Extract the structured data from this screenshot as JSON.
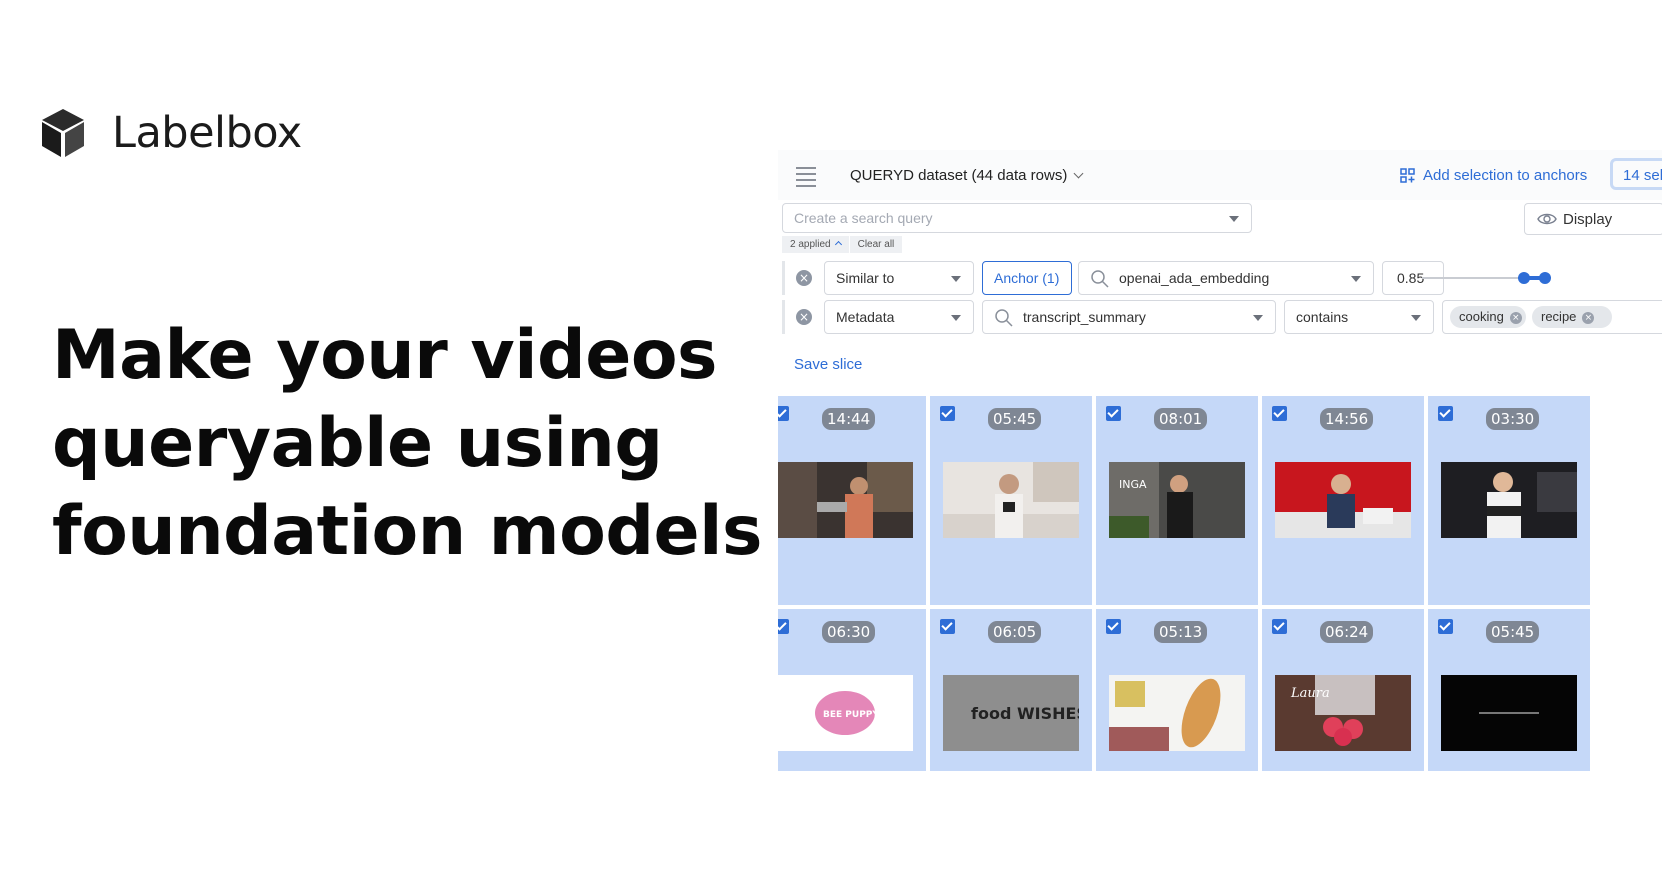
{
  "brand": {
    "name": "Labelbox"
  },
  "headline": {
    "line1": "Make your videos",
    "line2": "queryable using",
    "line3": "foundation models"
  },
  "app": {
    "dataset_title": "QUERYD dataset (44 data rows)",
    "add_to_anchors": "Add selection to anchors",
    "selected_label": "14 sel",
    "search_placeholder": "Create a search query",
    "display_label": "Display",
    "applied_label": "2 applied",
    "clear_all": "Clear all",
    "filter1": {
      "type": "Similar to",
      "anchor": "Anchor (1)",
      "embedding": "openai_ada_embedding",
      "threshold": "0.85",
      "slider_value": 0.85
    },
    "filter2": {
      "type": "Metadata",
      "field": "transcript_summary",
      "operator": "contains",
      "tags": [
        "cooking",
        "recipe"
      ]
    },
    "save_slice": "Save slice",
    "accent_color": "#2e6dd6",
    "tile_color": "#c5d8f8"
  },
  "videos": [
    {
      "duration": "14:44",
      "checked": true
    },
    {
      "duration": "05:45",
      "checked": true
    },
    {
      "duration": "08:01",
      "checked": true,
      "overlay": "INGA"
    },
    {
      "duration": "14:56",
      "checked": true
    },
    {
      "duration": "03:30",
      "checked": true
    },
    {
      "duration": "06:30",
      "checked": true,
      "overlay": "BEE PUPPYCAT"
    },
    {
      "duration": "06:05",
      "checked": true,
      "overlay": "food WISHES"
    },
    {
      "duration": "05:13",
      "checked": true
    },
    {
      "duration": "06:24",
      "checked": true,
      "overlay": "Laura"
    },
    {
      "duration": "05:45",
      "checked": true
    }
  ]
}
